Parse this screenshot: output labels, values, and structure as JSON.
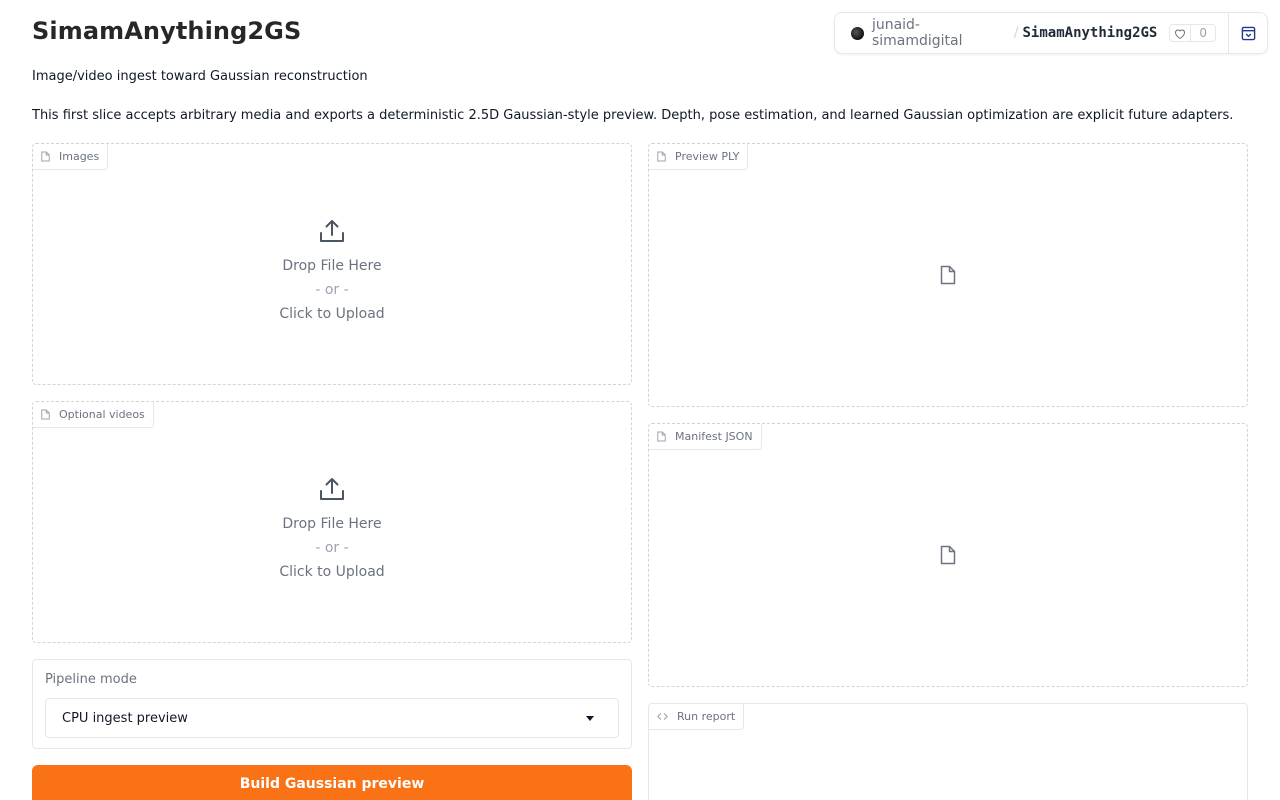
{
  "header": {
    "title": "SimamAnything2GS",
    "subtitle": "Image/video ingest toward Gaussian reconstruction",
    "description": "This first slice accepts arbitrary media and exports a deterministic 2.5D Gaussian-style preview. Depth, pose estimation, and learned Gaussian optimization are explicit future adapters."
  },
  "space_badge": {
    "owner": "junaid-simamdigital",
    "separator": "/",
    "space": "SimamAnything2GS",
    "likes": "0"
  },
  "inputs": {
    "images": {
      "label": "Images",
      "drop": "Drop File Here",
      "or": "- or -",
      "click": "Click to Upload"
    },
    "videos": {
      "label": "Optional videos",
      "drop": "Drop File Here",
      "or": "- or -",
      "click": "Click to Upload"
    }
  },
  "outputs": {
    "preview_ply": {
      "label": "Preview PLY"
    },
    "manifest_json": {
      "label": "Manifest JSON"
    },
    "run_report": {
      "label": "Run report"
    }
  },
  "pipeline": {
    "label": "Pipeline mode",
    "selected": "CPU ingest preview"
  },
  "actions": {
    "build_label": "Build Gaussian preview"
  },
  "colors": {
    "accent": "#f97316",
    "border": "#e5e7eb",
    "muted_text": "#6b7280"
  }
}
